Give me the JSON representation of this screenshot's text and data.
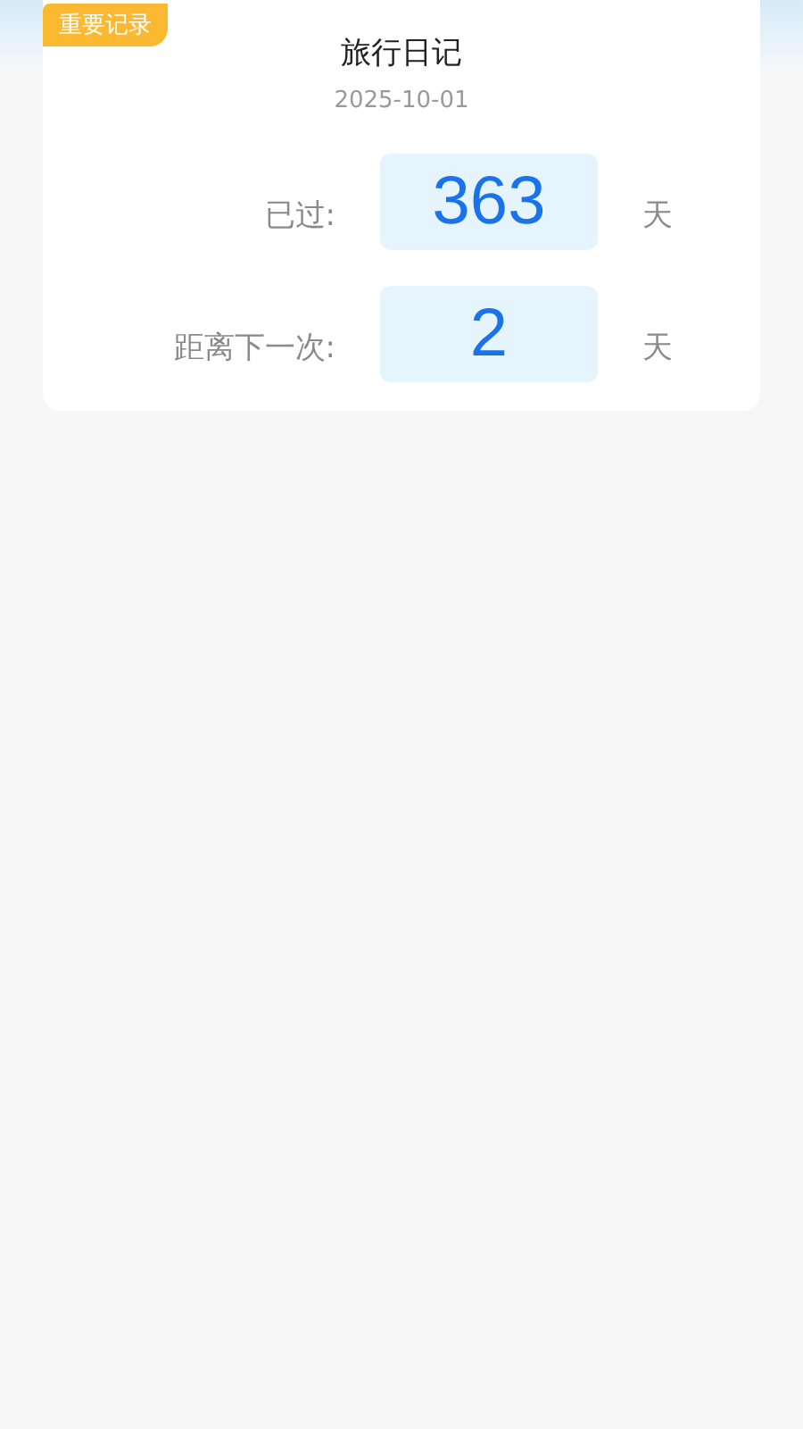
{
  "card": {
    "tag": "重要记录",
    "title": "旅行日记",
    "date": "2025-10-01",
    "rows": [
      {
        "label": "已过:",
        "value": "363",
        "unit": "天"
      },
      {
        "label": "距离下一次:",
        "value": "2",
        "unit": "天"
      }
    ]
  }
}
